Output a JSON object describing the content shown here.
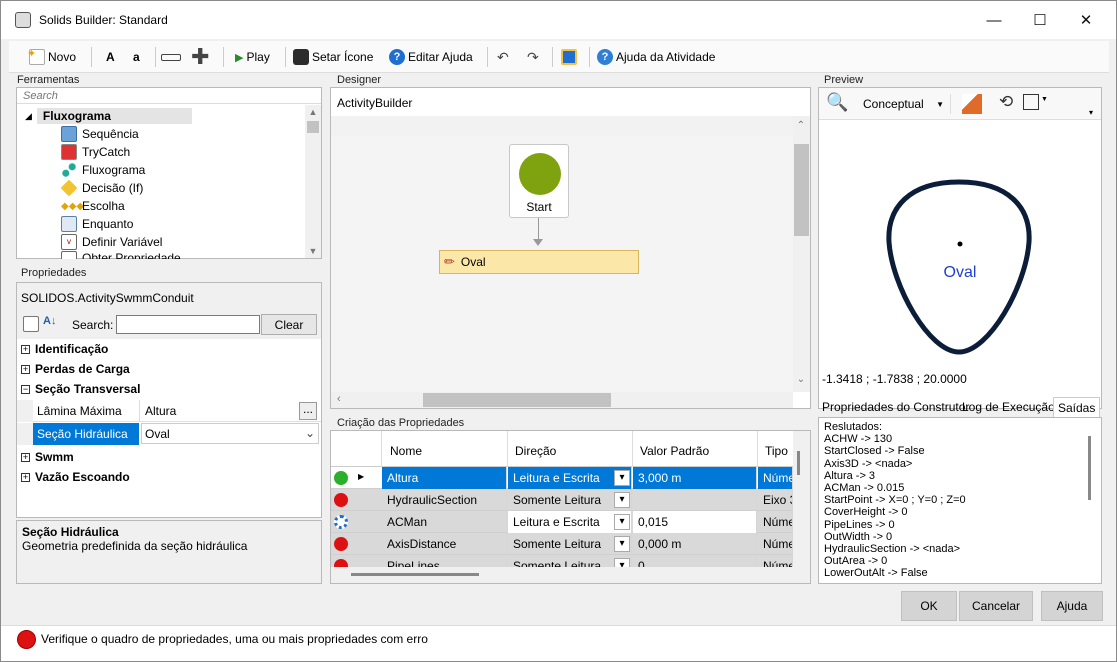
{
  "window": {
    "title": "Solids Builder: Standard"
  },
  "toolbar": {
    "new_label": "Novo",
    "bold_a": "A",
    "small_a": "a",
    "play_label": "Play",
    "set_icon_label": "Setar Ícone",
    "edit_help_label": "Editar Ajuda",
    "activity_help_label": "Ajuda da Atividade"
  },
  "tools": {
    "group_title": "Ferramentas",
    "search_placeholder": "Search",
    "root": "Fluxograma",
    "items": [
      "Sequência",
      "TryCatch",
      "Fluxograma",
      "Decisão (If)",
      "Escolha",
      "Enquanto",
      "Definir Variável",
      "Obter Propriedade"
    ]
  },
  "designer": {
    "group_title": "Designer",
    "breadcrumb": "ActivityBuilder",
    "start_label": "Start",
    "activity_label": "Oval"
  },
  "properties": {
    "group_title": "Propriedades",
    "object_name": "SOLIDOS.ActivitySwmmConduit",
    "search_label": "Search:",
    "search_value": "",
    "clear_label": "Clear",
    "categories": [
      {
        "sign": "+",
        "label": "Identificação"
      },
      {
        "sign": "+",
        "label": "Perdas de Carga"
      },
      {
        "sign": "−",
        "label": "Seção Transversal"
      },
      {
        "sign": "+",
        "label": "Swmm"
      },
      {
        "sign": "+",
        "label": "Vazão Escoando"
      }
    ],
    "rows": [
      {
        "name": "Lâmina Máxima",
        "value": "Altura",
        "button": "..."
      },
      {
        "name": "Seção Hidráulica",
        "value": "Oval",
        "button": "⌄"
      }
    ],
    "help_title": "Seção Hidráulica",
    "help_text": "Geometria predefinida da seção hidráulica"
  },
  "creation": {
    "group_title": "Criação das Propriedades",
    "columns": [
      "Nome",
      "Direção",
      "Valor Padrão",
      "Tipo"
    ],
    "rows": [
      {
        "name": "Altura",
        "direction": "Leitura e Escrita",
        "value": "3,000 m",
        "type": "Númer",
        "selected": true
      },
      {
        "name": "HydraulicSection",
        "direction": "Somente Leitura",
        "value": "",
        "type": "Eixo 3",
        "selected": false
      },
      {
        "name": "ACMan",
        "direction": "Leitura e Escrita",
        "value": "0,015",
        "type": "Númer",
        "selected": false
      },
      {
        "name": "AxisDistance",
        "direction": "Somente Leitura",
        "value": "0,000 m",
        "type": "Númer",
        "selected": false
      },
      {
        "name": "PipeLines",
        "direction": "Somente Leitura",
        "value": "0",
        "type": "Númer",
        "selected": false
      }
    ]
  },
  "preview": {
    "group_title": "Preview",
    "mode": "Conceptual",
    "shape_label": "Oval",
    "coords": "-1.3418 ; -1.7838 ; 20.0000"
  },
  "output": {
    "tabs": [
      "Propriedades do Construtor",
      "Log de Execução",
      "Saídas"
    ],
    "lines": [
      "Reslutados:",
      "ACHW -> 130",
      "StartClosed -> False",
      "Axis3D -> <nada>",
      "Altura -> 3",
      "ACMan -> 0.015",
      "StartPoint -> X=0 ; Y=0 ; Z=0",
      "CoverHeight -> 0",
      "PipeLines -> 0",
      "OutWidth -> 0",
      "HydraulicSection -> <nada>",
      "OutArea -> 0",
      "LowerOutAlt -> False"
    ]
  },
  "buttons": {
    "ok": "OK",
    "cancel": "Cancelar",
    "help": "Ajuda"
  },
  "status": {
    "message": "Verifique o quadro de propriedades, uma ou mais propriedades com erro"
  },
  "colors": {
    "accent": "#0078d7",
    "error": "#dd1111",
    "start": "#7ea30f",
    "activity_bg": "#fbe7a8"
  }
}
